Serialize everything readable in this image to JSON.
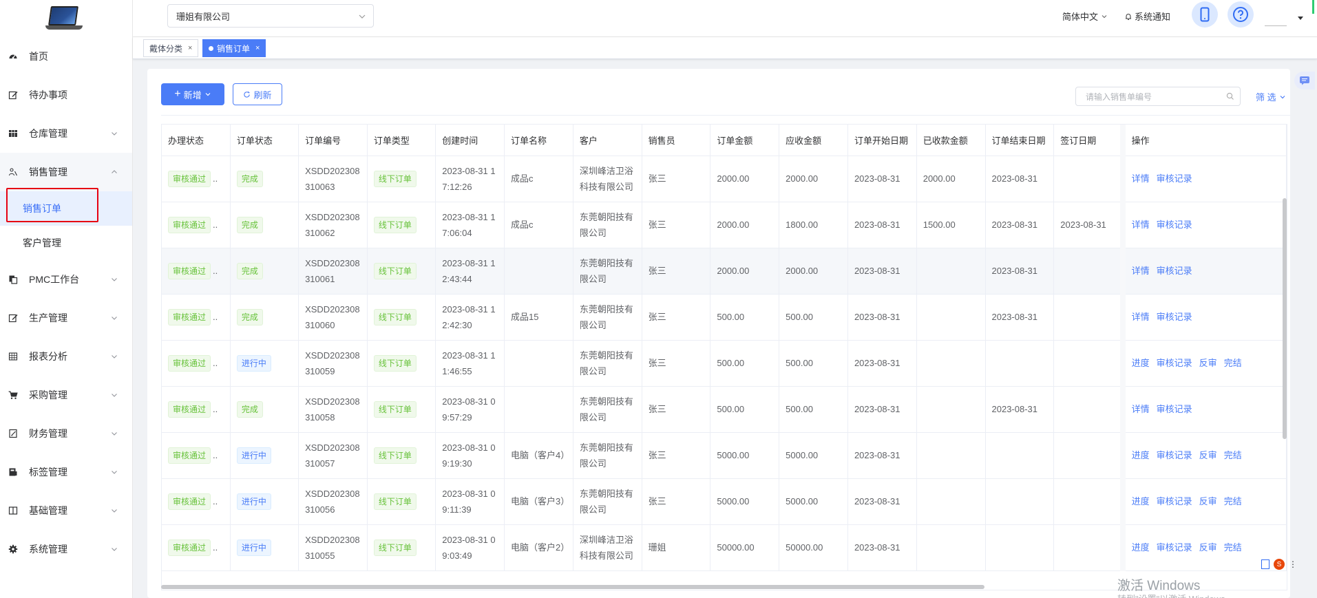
{
  "sidebar": {
    "items": [
      {
        "label": "首页",
        "icon": "dashboard-icon"
      },
      {
        "label": "待办事项",
        "icon": "edit-icon"
      },
      {
        "label": "仓库管理",
        "icon": "table-icon"
      },
      {
        "label": "销售管理",
        "icon": "user-group-icon"
      },
      {
        "label": "PMC工作台",
        "icon": "copy-icon"
      },
      {
        "label": "生产管理",
        "icon": "edit-icon"
      },
      {
        "label": "报表分析",
        "icon": "grid-icon"
      },
      {
        "label": "采购管理",
        "icon": "cart-icon"
      },
      {
        "label": "财务管理",
        "icon": "document-icon"
      },
      {
        "label": "标签管理",
        "icon": "tag-icon"
      },
      {
        "label": "基础管理",
        "icon": "book-icon"
      },
      {
        "label": "系统管理",
        "icon": "gear-icon"
      }
    ],
    "sales_sub": [
      "销售订单",
      "客户管理"
    ]
  },
  "header": {
    "company": "珊姐有限公司",
    "language": "简体中文",
    "notice": "系统通知"
  },
  "tabs": [
    {
      "label": "戴体分类"
    },
    {
      "label": "销售订单"
    }
  ],
  "toolbar": {
    "new_label": "新增",
    "refresh_label": "刷新",
    "search_placeholder": "请输入销售单编号",
    "filter_label": "筛 选"
  },
  "table": {
    "columns": [
      "办理状态",
      "订单状态",
      "订单编号",
      "订单类型",
      "创建时间",
      "订单名称",
      "客户",
      "销售员",
      "订单金额",
      "应收金额",
      "订单开始日期",
      "已收款金额",
      "订单结束日期",
      "签订日期",
      "操作"
    ],
    "rows": [
      {
        "proc": "审核通过",
        "status": "完成",
        "status_type": "green",
        "no": "XSDD202308310063",
        "type": "线下订单",
        "time": "2023-08-31 17:12:26",
        "name": "成品c",
        "customer": "深圳峰洁卫浴科技有限公司",
        "sales": "张三",
        "amount": "2000.00",
        "receivable": "2000.00",
        "start": "2023-08-31",
        "received": "2000.00",
        "end": "2023-08-31",
        "sign": "",
        "ops": [
          "详情",
          "审核记录"
        ]
      },
      {
        "proc": "审核通过",
        "status": "完成",
        "status_type": "green",
        "no": "XSDD202308310062",
        "type": "线下订单",
        "time": "2023-08-31 17:06:04",
        "name": "成品c",
        "customer": "东莞朝阳技有限公司",
        "sales": "张三",
        "amount": "2000.00",
        "receivable": "1800.00",
        "start": "2023-08-31",
        "received": "1500.00",
        "end": "2023-08-31",
        "sign": "2023-08-31",
        "ops": [
          "详情",
          "审核记录"
        ]
      },
      {
        "proc": "审核通过",
        "status": "完成",
        "status_type": "green",
        "no": "XSDD202308310061",
        "type": "线下订单",
        "time": "2023-08-31 12:43:44",
        "name": "",
        "customer": "东莞朝阳技有限公司",
        "sales": "张三",
        "amount": "2000.00",
        "receivable": "2000.00",
        "start": "2023-08-31",
        "received": "",
        "end": "2023-08-31",
        "sign": "",
        "ops": [
          "详情",
          "审核记录"
        ]
      },
      {
        "proc": "审核通过",
        "status": "完成",
        "status_type": "green",
        "no": "XSDD202308310060",
        "type": "线下订单",
        "time": "2023-08-31 12:42:30",
        "name": "成品15",
        "customer": "东莞朝阳技有限公司",
        "sales": "张三",
        "amount": "500.00",
        "receivable": "500.00",
        "start": "2023-08-31",
        "received": "",
        "end": "2023-08-31",
        "sign": "",
        "ops": [
          "详情",
          "审核记录"
        ]
      },
      {
        "proc": "审核通过",
        "status": "进行中",
        "status_type": "blue",
        "no": "XSDD202308310059",
        "type": "线下订单",
        "time": "2023-08-31 11:46:55",
        "name": "",
        "customer": "东莞朝阳技有限公司",
        "sales": "张三",
        "amount": "500.00",
        "receivable": "500.00",
        "start": "2023-08-31",
        "received": "",
        "end": "",
        "sign": "",
        "ops": [
          "进度",
          "审核记录",
          "反审",
          "完结"
        ]
      },
      {
        "proc": "审核通过",
        "status": "完成",
        "status_type": "green",
        "no": "XSDD202308310058",
        "type": "线下订单",
        "time": "2023-08-31 09:57:29",
        "name": "",
        "customer": "东莞朝阳技有限公司",
        "sales": "张三",
        "amount": "500.00",
        "receivable": "500.00",
        "start": "2023-08-31",
        "received": "",
        "end": "2023-08-31",
        "sign": "",
        "ops": [
          "详情",
          "审核记录"
        ]
      },
      {
        "proc": "审核通过",
        "status": "进行中",
        "status_type": "blue",
        "no": "XSDD202308310057",
        "type": "线下订单",
        "time": "2023-08-31 09:19:30",
        "name": "电脑（客户4）",
        "customer": "东莞朝阳技有限公司",
        "sales": "张三",
        "amount": "5000.00",
        "receivable": "5000.00",
        "start": "2023-08-31",
        "received": "",
        "end": "",
        "sign": "",
        "ops": [
          "进度",
          "审核记录",
          "反审",
          "完结"
        ]
      },
      {
        "proc": "审核通过",
        "status": "进行中",
        "status_type": "blue",
        "no": "XSDD202308310056",
        "type": "线下订单",
        "time": "2023-08-31 09:11:39",
        "name": "电脑（客户3）",
        "customer": "东莞朝阳技有限公司",
        "sales": "张三",
        "amount": "5000.00",
        "receivable": "5000.00",
        "start": "2023-08-31",
        "received": "",
        "end": "",
        "sign": "",
        "ops": [
          "进度",
          "审核记录",
          "反审",
          "完结"
        ]
      },
      {
        "proc": "审核通过",
        "status": "进行中",
        "status_type": "blue",
        "no": "XSDD202308310055",
        "type": "线下订单",
        "time": "2023-08-31 09:03:49",
        "name": "电脑（客户2）",
        "customer": "深圳峰洁卫浴科技有限公司",
        "sales": "珊姐",
        "amount": "50000.00",
        "receivable": "50000.00",
        "start": "2023-08-31",
        "received": "",
        "end": "",
        "sign": "",
        "ops": [
          "进度",
          "审核记录",
          "反审",
          "完结"
        ]
      }
    ]
  },
  "watermark": {
    "line1": "激活 Windows",
    "line2": "转到\"设置\"以激活 Windows。"
  },
  "colors": {
    "primary": "#4a7cf7",
    "success": "#67c23a",
    "highlight_box": "#e60012"
  }
}
